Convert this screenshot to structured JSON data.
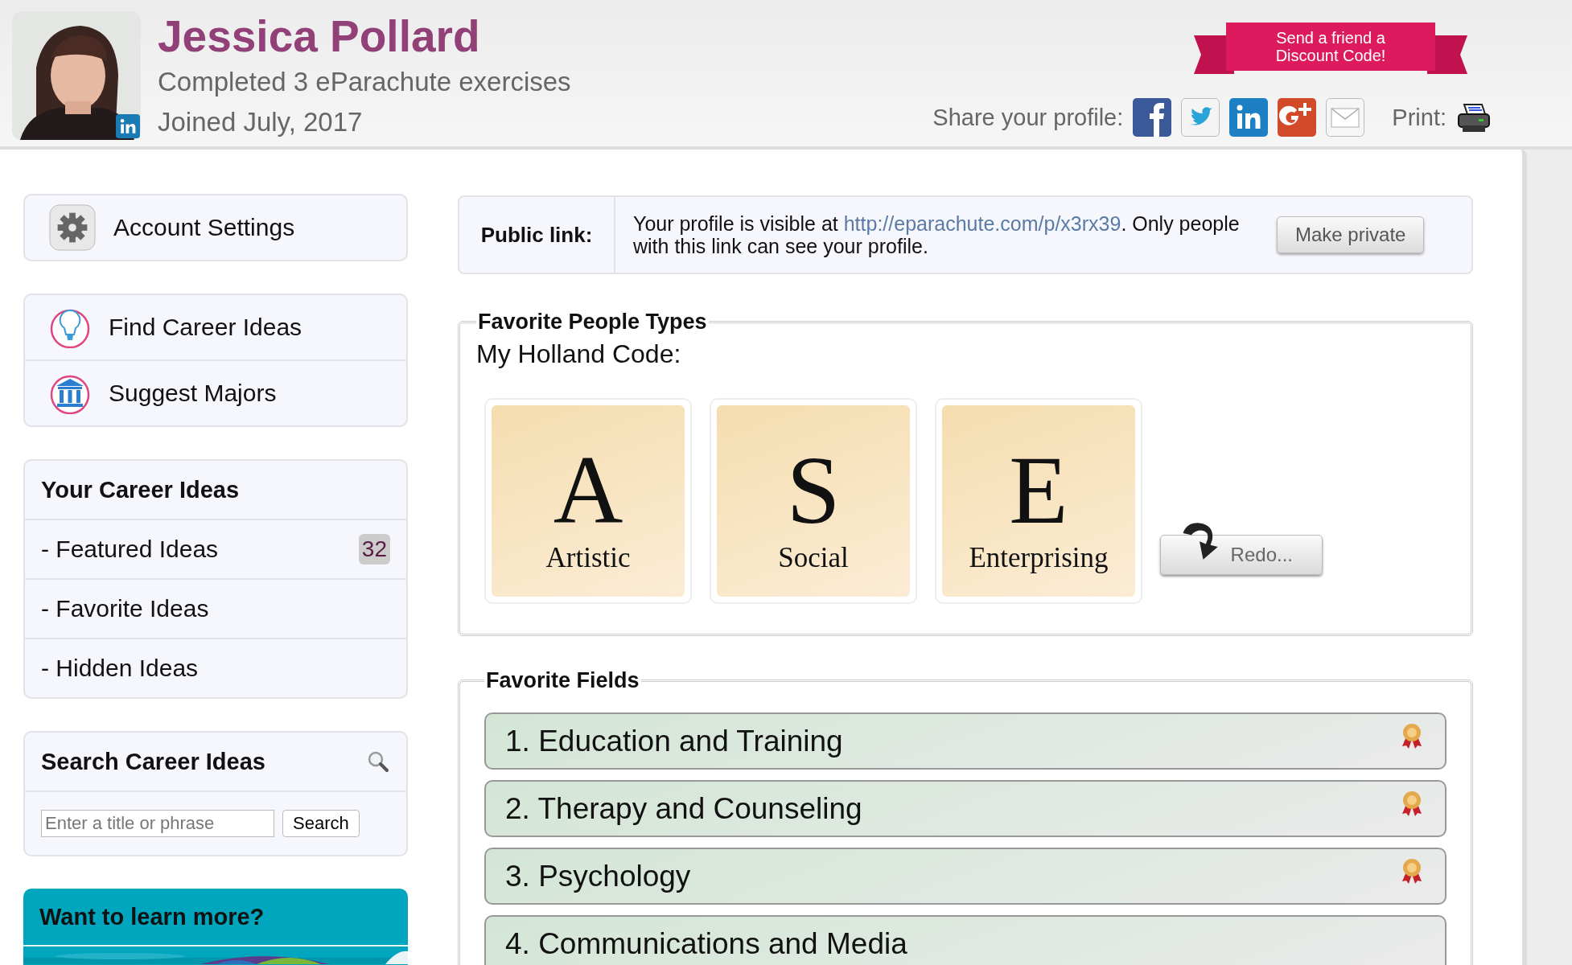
{
  "profile": {
    "name": "Jessica Pollard",
    "completed": "Completed 3 eParachute exercises",
    "joined": "Joined July, 2017"
  },
  "promo": {
    "label": "Send a friend a Discount Code!"
  },
  "share": {
    "label": "Share your profile:",
    "print_label": "Print:"
  },
  "sidebar": {
    "account": {
      "label": "Account Settings"
    },
    "tools": [
      {
        "label": "Find Career Ideas",
        "kind": "bulb"
      },
      {
        "label": "Suggest Majors",
        "kind": "college"
      }
    ],
    "career_ideas": {
      "title": "Your Career Ideas",
      "items": [
        {
          "label": "- Featured Ideas",
          "count": "32"
        },
        {
          "label": "- Favorite Ideas"
        },
        {
          "label": "- Hidden Ideas"
        }
      ]
    },
    "search": {
      "title": "Search Career Ideas",
      "placeholder": "Enter a title or phrase",
      "button": "Search"
    },
    "learn_more": {
      "title": "Want to learn more?"
    }
  },
  "public_link": {
    "label": "Public link:",
    "text_before": "Your profile is visible at ",
    "url": "http://eparachute.com/p/x3rx39",
    "text_after": ". Only people with this link can see your profile.",
    "button": "Make private"
  },
  "people_types": {
    "legend": "Favorite People Types",
    "subtitle": "My Holland Code:",
    "redo": "Redo...",
    "codes": [
      {
        "letter": "A",
        "name": "Artistic"
      },
      {
        "letter": "S",
        "name": "Social"
      },
      {
        "letter": "E",
        "name": "Enterprising"
      }
    ]
  },
  "fields": {
    "legend": "Favorite Fields",
    "items": [
      {
        "label": "1. Education and Training",
        "award": true
      },
      {
        "label": "2. Therapy and Counseling",
        "award": true
      },
      {
        "label": "3. Psychology",
        "award": true
      },
      {
        "label": "4. Communications and Media",
        "award": false
      }
    ]
  }
}
